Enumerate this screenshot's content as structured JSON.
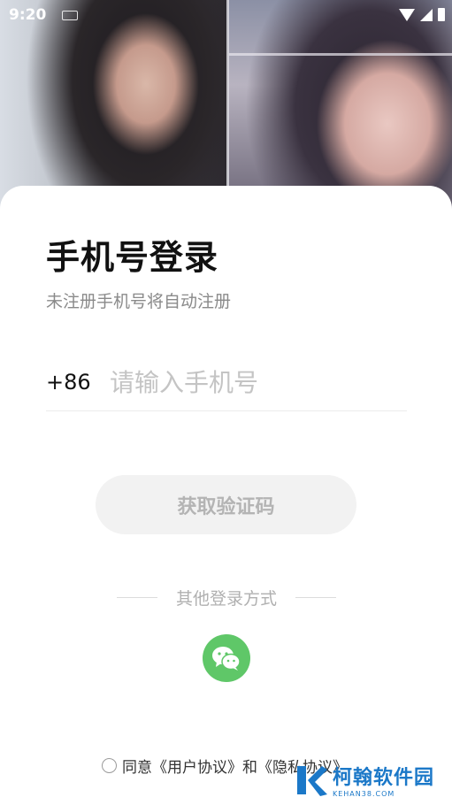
{
  "status_bar": {
    "time": "9:20"
  },
  "login": {
    "title": "手机号登录",
    "subtitle": "未注册手机号将自动注册",
    "country_code": "+86",
    "phone_placeholder": "请输入手机号",
    "get_code_label": "获取验证码",
    "other_login_label": "其他登录方式"
  },
  "agreement": {
    "prefix": "同意",
    "user_agreement": "《用户协议》",
    "and": "和",
    "privacy_policy": "《隐私协议》"
  },
  "watermark": {
    "cn": "柯翰软件园",
    "en": "KEHAN38.COM"
  },
  "icons": {
    "status": [
      "wifi-icon",
      "signal-icon",
      "battery-icon"
    ],
    "login": "wechat-icon",
    "watermark": "kehan-logo-icon"
  },
  "colors": {
    "wechat_green": "#5fc768",
    "button_bg": "#f2f2f2",
    "button_text": "#b4b4b4",
    "subtitle": "#8a8a8a",
    "watermark_blue": "#1b78c8"
  }
}
